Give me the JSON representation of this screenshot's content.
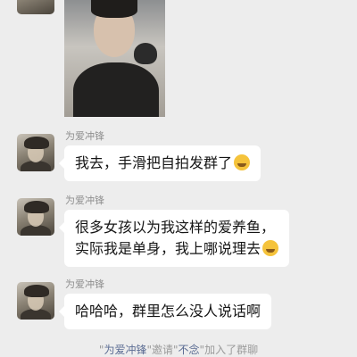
{
  "messages": [
    {
      "sender": "为爱冲锋",
      "text": "我去，手滑把自拍发群了",
      "emoji": "crying-laughing-emoji"
    },
    {
      "sender": "为爱冲锋",
      "line1": "很多女孩以为我这样的爱养鱼，",
      "line2": "实际我是单身，我上哪说理去",
      "emoji": "weary-face-emoji"
    },
    {
      "sender": "为爱冲锋",
      "text": "哈哈哈，群里怎么没人说话啊"
    }
  ],
  "system": {
    "q1": "\"",
    "inviter": "为爱冲锋",
    "mid": "\"邀请\"",
    "invitee": "不念",
    "q2": "\"",
    "tail": "加入了群聊"
  }
}
